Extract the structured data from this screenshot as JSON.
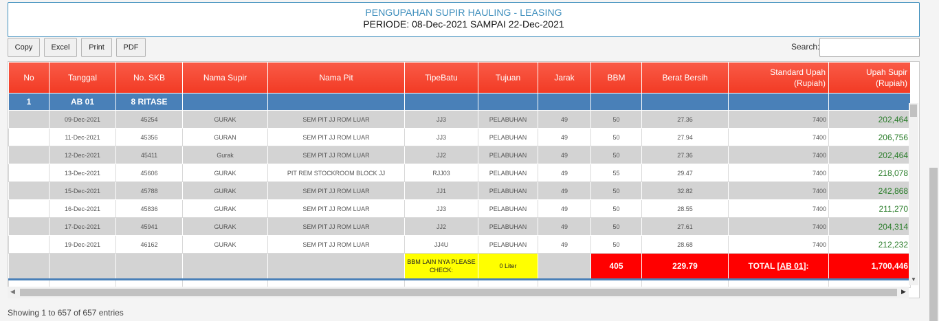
{
  "header": {
    "title": "PENGUPAHAN SUPIR HAULING - LEASING",
    "period": "PERIODE: 08-Dec-2021 SAMPAI 22-Dec-2021"
  },
  "toolbar": {
    "copy_label": "Copy",
    "excel_label": "Excel",
    "print_label": "Print",
    "pdf_label": "PDF",
    "search_label": "Search:",
    "search_value": ""
  },
  "table": {
    "columns": [
      "No",
      "Tanggal",
      "No. SKB",
      "Nama Supir",
      "Nama Pit",
      "TipeBatu",
      "Tujuan",
      "Jarak",
      "BBM",
      "Berat Bersih",
      "Standard Upah\n(Rupiah)",
      "Upah Supir\n(Rupiah)"
    ],
    "group": {
      "no": "1",
      "tanggal": "AB 01",
      "skb": "8 RITASE"
    },
    "rows": [
      [
        "",
        "09-Dec-2021",
        "45254",
        "GURAK",
        "SEM PIT JJ ROM LUAR",
        "JJ3",
        "PELABUHAN",
        "49",
        "50",
        "27.36",
        "7400",
        "202,464"
      ],
      [
        "",
        "11-Dec-2021",
        "45356",
        "GURAN",
        "SEM PIT JJ ROM LUAR",
        "JJ3",
        "PELABUHAN",
        "49",
        "50",
        "27.94",
        "7400",
        "206,756"
      ],
      [
        "",
        "12-Dec-2021",
        "45411",
        "Gurak",
        "SEM PIT JJ ROM LUAR",
        "JJ2",
        "PELABUHAN",
        "49",
        "50",
        "27.36",
        "7400",
        "202,464"
      ],
      [
        "",
        "13-Dec-2021",
        "45606",
        "GURAK",
        "PIT REM STOCKROOM BLOCK JJ",
        "RJJ03",
        "PELABUHAN",
        "49",
        "55",
        "29.47",
        "7400",
        "218,078"
      ],
      [
        "",
        "15-Dec-2021",
        "45788",
        "GURAK",
        "SEM PIT JJ ROM LUAR",
        "JJ1",
        "PELABUHAN",
        "49",
        "50",
        "32.82",
        "7400",
        "242,868"
      ],
      [
        "",
        "16-Dec-2021",
        "45836",
        "GURAK",
        "SEM PIT JJ ROM LUAR",
        "JJ3",
        "PELABUHAN",
        "49",
        "50",
        "28.55",
        "7400",
        "211,270"
      ],
      [
        "",
        "17-Dec-2021",
        "45941",
        "GURAK",
        "SEM PIT JJ ROM LUAR",
        "JJ2",
        "PELABUHAN",
        "49",
        "50",
        "27.61",
        "7400",
        "204,314"
      ],
      [
        "",
        "19-Dec-2021",
        "46162",
        "GURAK",
        "SEM PIT JJ ROM LUAR",
        "JJ4U",
        "PELABUHAN",
        "49",
        "50",
        "28.68",
        "7400",
        "212,232"
      ]
    ],
    "total": {
      "bbm_note": "BBM LAIN NYA PLEASE CHECK:",
      "liter": "0 Liter",
      "bbm": "405",
      "berat": "229.79",
      "total_prefix": "TOTAL [",
      "total_link": "AB 01",
      "total_suffix": "]:",
      "upah": "1,700,446"
    }
  },
  "footer": {
    "info": "Showing 1 to 657 of 657 entries"
  },
  "colors": {
    "header_red": "#f23a24",
    "group_blue": "#4980b8",
    "wage_green": "#2a7d2a",
    "highlight_yellow": "#ffff00",
    "total_red": "#ff0000"
  },
  "icons": [
    "scroll-left-icon",
    "scroll-right-icon",
    "scroll-down-icon"
  ]
}
